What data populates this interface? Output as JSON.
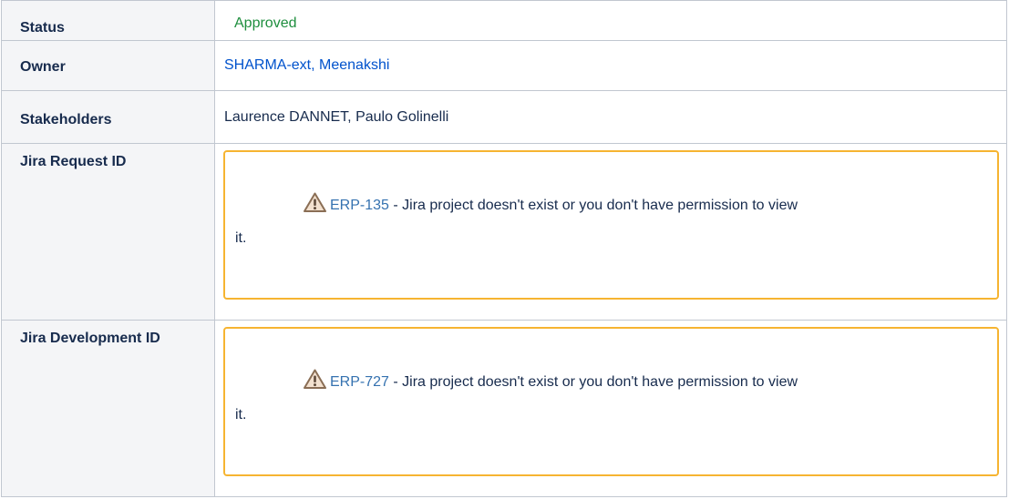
{
  "rows": [
    {
      "label": "Status",
      "value": "Approved"
    },
    {
      "label": "Owner",
      "value": "SHARMA-ext, Meenakshi"
    },
    {
      "label": "Stakeholders",
      "value": "Laurence DANNET, Paulo Golinelli"
    },
    {
      "label": "Jira Request ID",
      "issue_key": "ERP-135",
      "message_line1": "- Jira project doesn't exist or you don't have permission to view",
      "message_line2": "it.",
      "icon": "warning-icon"
    },
    {
      "label": "Jira Development ID",
      "issue_key": "ERP-727",
      "message_line1": "- Jira project doesn't exist or you don't have permission to view",
      "message_line2": "it.",
      "icon": "warning-icon"
    }
  ],
  "colors": {
    "status_green": "#1e8e3e",
    "link_blue": "#0052cc",
    "jira_link": "#3572b0",
    "panel_border": "#f6b431",
    "header_bg": "#f4f5f7",
    "border": "#c1c7d0"
  }
}
